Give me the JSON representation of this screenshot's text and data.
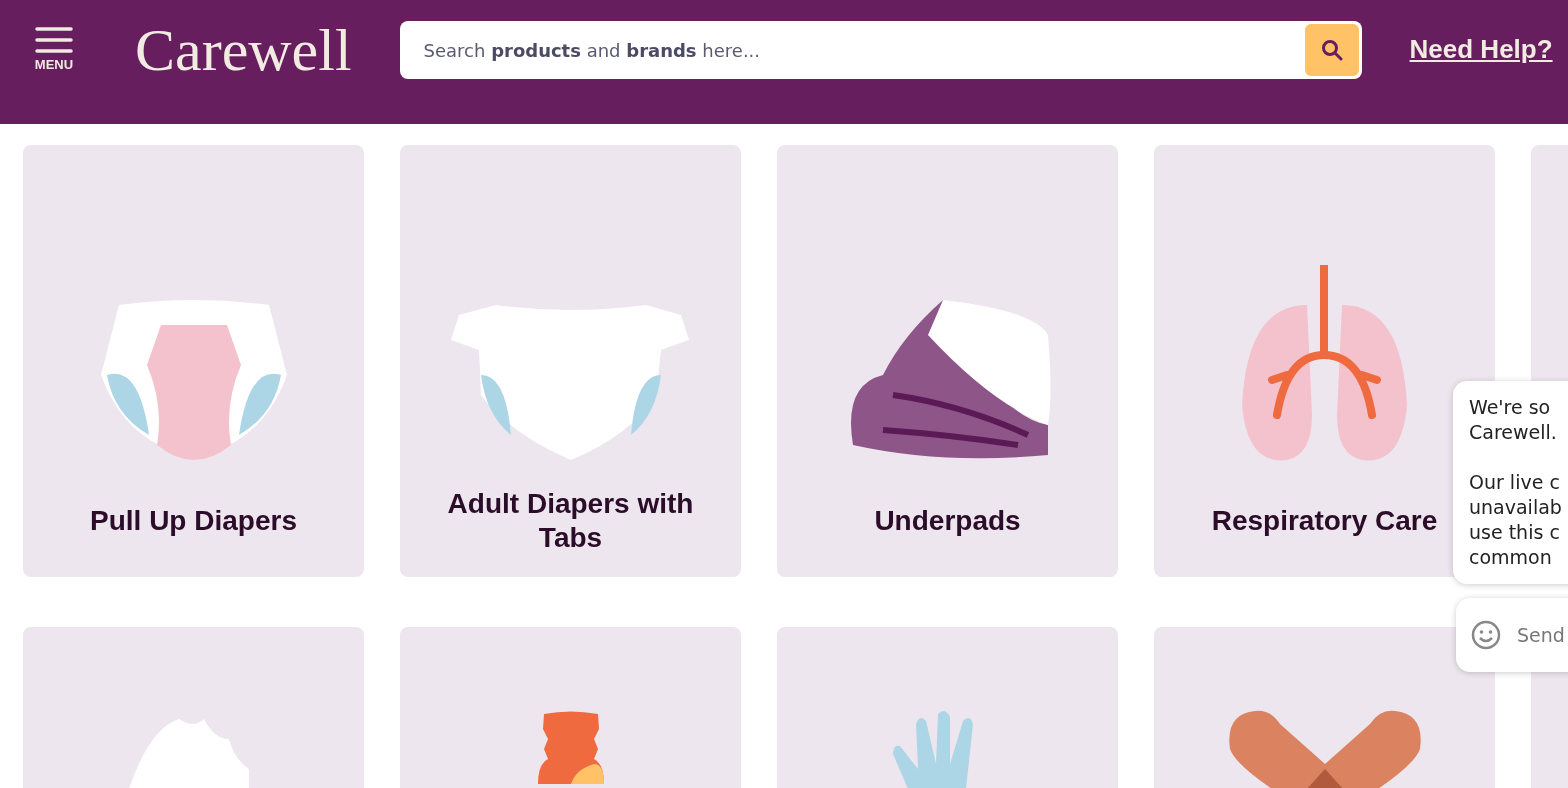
{
  "header": {
    "menu_label": "MENU",
    "logo": "Carewell",
    "search_placeholder": "Search **products** and **brands** here...",
    "help_link": "Need Help?"
  },
  "categories": [
    {
      "kind": "pullup",
      "title": "Pull Up Diapers"
    },
    {
      "kind": "tabs",
      "title": "Adult Diapers with Tabs"
    },
    {
      "kind": "underpad",
      "title": "Underpads"
    },
    {
      "kind": "lungs",
      "title": "Respiratory Care"
    },
    {
      "kind": "blank"
    },
    {
      "kind": "cream"
    },
    {
      "kind": "bottle"
    },
    {
      "kind": "glove"
    },
    {
      "kind": "bandage"
    },
    {
      "kind": "blank"
    }
  ],
  "chat": {
    "paragraphs": [
      [
        "We're so",
        "Carewell."
      ],
      [
        "Our live c",
        "unavailab",
        "use this c",
        "common"
      ]
    ],
    "input_placeholder": "Send"
  }
}
